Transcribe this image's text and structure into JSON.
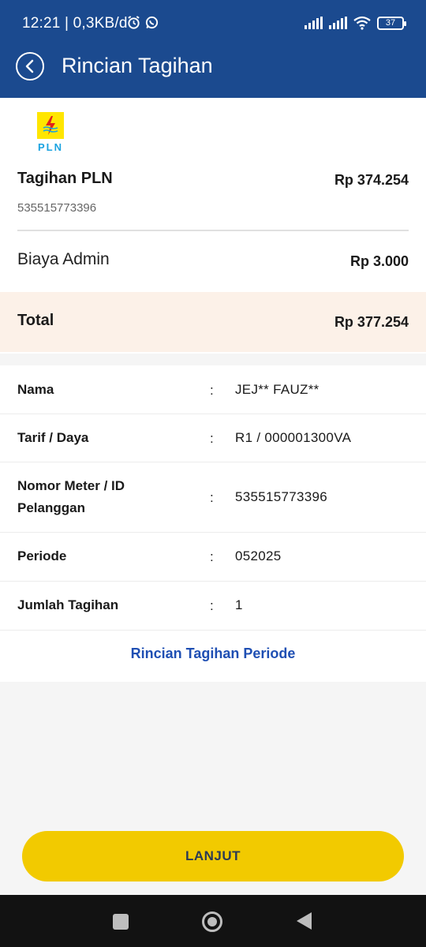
{
  "status_bar": {
    "time": "12:21 | 0,3KB/d",
    "battery": "37",
    "icons": [
      "alarm-icon",
      "whatsapp-icon",
      "signal-icon",
      "signal-icon",
      "wifi-icon",
      "battery-icon"
    ]
  },
  "app_bar": {
    "title": "Rincian Tagihan",
    "back_icon": "chevron-left-icon",
    "color": "#1b4a8f"
  },
  "bill": {
    "logo_text": "PLN",
    "title": "Tagihan PLN",
    "amount": "Rp 374.254",
    "customer_id": "535515773396",
    "admin_label": "Biaya Admin",
    "admin_amount": "Rp 3.000",
    "total_label": "Total",
    "total_amount": "Rp 377.254"
  },
  "details": {
    "rows": [
      {
        "label": "Nama",
        "sep": ":",
        "value": "JEJ** FAUZ**"
      },
      {
        "label": "Tarif / Daya",
        "sep": ":",
        "value": "R1 / 000001300VA"
      },
      {
        "label": "Nomor Meter / ID Pelanggan",
        "sep": ":",
        "value": "535515773396"
      },
      {
        "label": "Periode",
        "sep": ":",
        "value": "052025"
      },
      {
        "label": "Jumlah Tagihan",
        "sep": ":",
        "value": "1"
      }
    ],
    "link_label": "Rincian Tagihan Periode"
  },
  "cta": {
    "label": "LANJUT",
    "color": "#f2ca00"
  },
  "nav_bar": {
    "icons": [
      "recent-apps-icon",
      "home-icon",
      "back-icon"
    ]
  }
}
